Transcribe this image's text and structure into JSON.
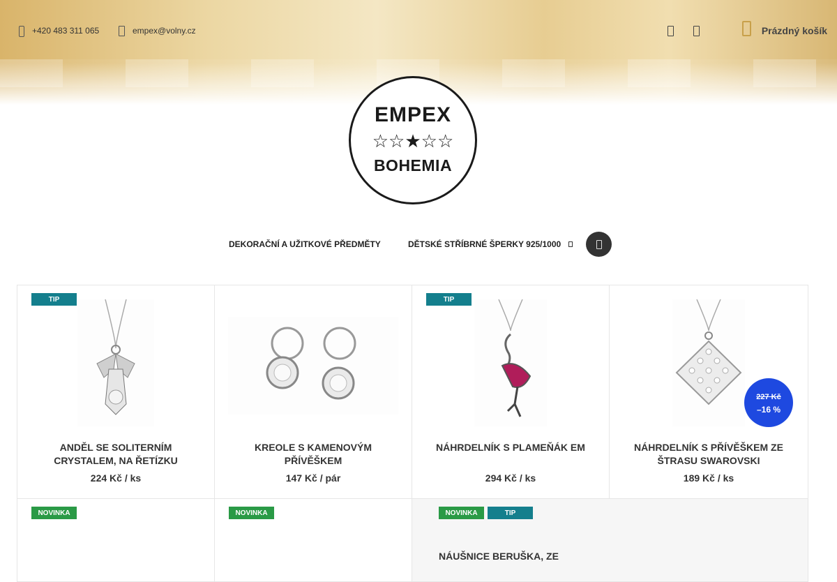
{
  "topbar": {
    "phone": "+420 483 311 065",
    "email": "empex@volny.cz",
    "cart_label": "Prázdný košík"
  },
  "logo": {
    "line1": "EMPEX",
    "stars": "☆☆★☆☆",
    "line2": "BOHEMIA"
  },
  "nav": {
    "items": [
      {
        "label": "DEKORAČNÍ A UŽITKOVÉ PŘEDMĚTY"
      },
      {
        "label": "DĚTSKÉ STŘÍBRNÉ ŠPERKY 925/1000"
      }
    ]
  },
  "colors": {
    "badge_tip": "#147f8d",
    "badge_new": "#2a9a46",
    "discount": "#1e49e0"
  },
  "products": [
    {
      "badges": [
        "TIP"
      ],
      "name": "ANDĚL SE SOLITERNÍM CRYSTALEM, NA ŘETÍZKU",
      "price": "224 Kč / ks",
      "image": "angel-pendant"
    },
    {
      "badges": [],
      "name": "KREOLE S KAMENOVÝM PŘÍVĚŠKEM",
      "price": "147 Kč / pár",
      "image": "hoop-earrings"
    },
    {
      "badges": [
        "TIP"
      ],
      "name": "NÁHRDELNÍK S PLAMEŇÁK EM",
      "price": "294 Kč / ks",
      "image": "flamingo-necklace"
    },
    {
      "badges": [],
      "name": "NÁHRDELNÍK S PŘÍVĚŠKEM ZE ŠTRASU SWAROVSKI",
      "price": "189 Kč / ks",
      "image": "strass-pendant",
      "old_price": "227 Kč",
      "discount": "–16 %"
    }
  ],
  "row2": [
    {
      "badges": [
        "NOVINKA"
      ]
    },
    {
      "badges": [
        "NOVINKA"
      ]
    },
    {
      "badges": [
        "NOVINKA",
        "TIP"
      ],
      "name": "NÁUŠNICE BERUŠKA, ZE"
    }
  ]
}
